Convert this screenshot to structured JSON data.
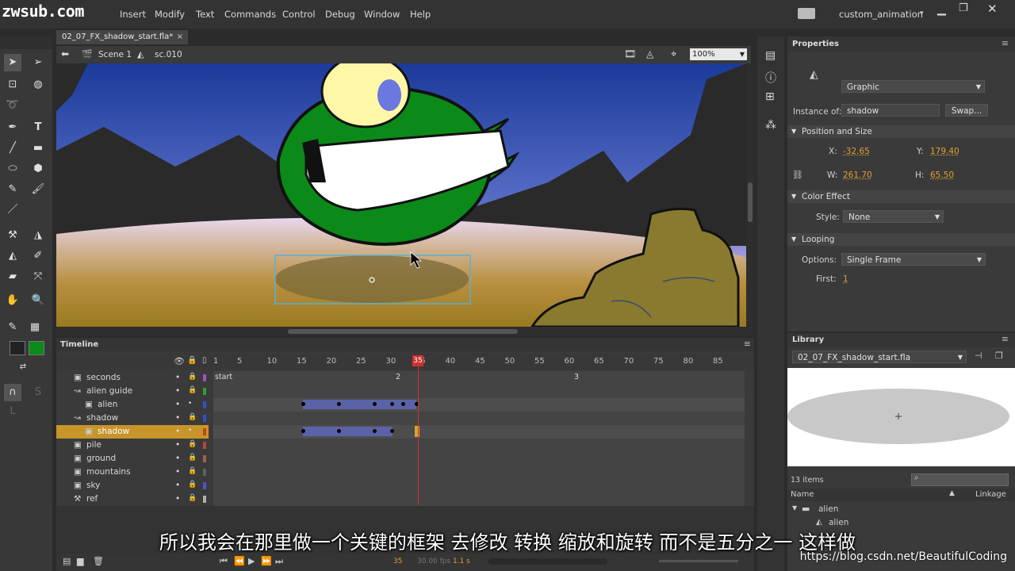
{
  "watermark": "zwsub.com",
  "menu": [
    "Insert",
    "Modify",
    "Text",
    "Commands",
    "Control",
    "Debug",
    "Window",
    "Help"
  ],
  "workspace": "custom_animation",
  "document": {
    "tab": "02_07_FX_shadow_start.fla*",
    "scene": "Scene 1",
    "symbol": "sc.010",
    "zoom": "100%"
  },
  "timeline": {
    "title": "Timeline",
    "frame_numbers": [
      "1",
      "5",
      "10",
      "15",
      "20",
      "25",
      "30",
      "35",
      "40",
      "45",
      "50",
      "55",
      "60",
      "65",
      "70",
      "75",
      "80",
      "85"
    ],
    "playhead": "35",
    "labels": [
      "start",
      "2",
      "3"
    ],
    "layers": [
      {
        "name": "seconds"
      },
      {
        "name": "alien guide"
      },
      {
        "name": "alien"
      },
      {
        "name": "shadow"
      },
      {
        "name": "shadow",
        "selected": true
      },
      {
        "name": "pile"
      },
      {
        "name": "ground"
      },
      {
        "name": "mountains"
      },
      {
        "name": "sky"
      },
      {
        "name": "ref"
      }
    ],
    "status": {
      "frame": "35",
      "fps": "30.00 fps",
      "time": "1.1 s"
    }
  },
  "properties": {
    "title": "Properties",
    "type": "Graphic",
    "instance_label": "Instance of:",
    "instance": "shadow",
    "swap": "Swap...",
    "position_section": "Position and Size",
    "x_label": "X:",
    "x": "-32.65",
    "y_label": "Y:",
    "y": "179.40",
    "w_label": "W:",
    "w": "261.70",
    "h_label": "H:",
    "h": "65.50",
    "color_section": "Color Effect",
    "style_label": "Style:",
    "style": "None",
    "looping_section": "Looping",
    "options_label": "Options:",
    "options": "Single Frame",
    "first_label": "First:",
    "first": "1"
  },
  "library": {
    "title": "Library",
    "file": "02_07_FX_shadow_start.fla",
    "count": "13 items",
    "col_name": "Name",
    "col_linkage": "Linkage",
    "items": [
      "alien",
      "alien"
    ]
  },
  "subtitle": "所以我会在那里做一个关键的框架  去修改  转换  缩放和旋转  而不是五分之一  这样做",
  "credit": "https://blog.csdn.net/BeautifulCoding",
  "colors": {
    "accent": "#e0a030",
    "selected_layer": "#c8952a",
    "tween": "#5a63a8",
    "playhead": "#d03030"
  }
}
